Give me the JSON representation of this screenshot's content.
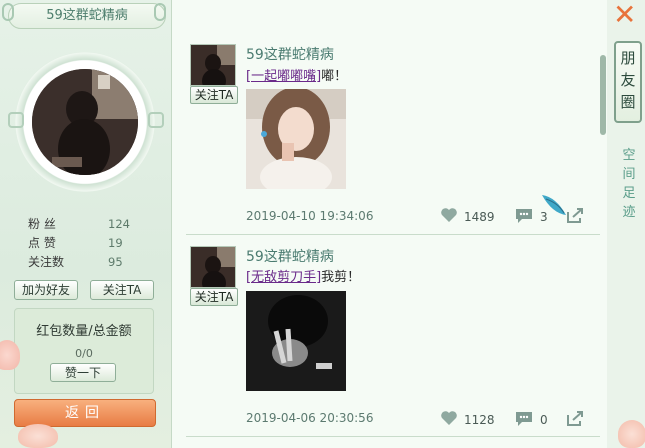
{
  "profile": {
    "name": "59这群蛇精病",
    "stats": [
      {
        "label": "粉 丝",
        "value": "124"
      },
      {
        "label": "点 赞",
        "value": "19"
      },
      {
        "label": "关注数",
        "value": "95"
      }
    ],
    "add_friend_label": "加为好友",
    "follow_label": "关注TA",
    "red_packet_title": "红包数量/总金额",
    "red_packet_count": "0/0",
    "like_button_label": "赞一下",
    "back_label": "返回"
  },
  "posts": [
    {
      "author": "59这群蛇精病",
      "follow_label": "关注TA",
      "tag": "[一起嘟嘟嘴]",
      "text": "嘟！",
      "date": "2019-04-10 19:34:06",
      "likes": "1489",
      "comments": "3"
    },
    {
      "author": "59这群蛇精病",
      "follow_label": "关注TA",
      "tag": "[无敌剪刀手]",
      "text": "我剪！",
      "date": "2019-04-06 20:30:56",
      "likes": "1128",
      "comments": "0"
    }
  ],
  "tabs": {
    "active": "朋友圈",
    "inactive": "空间足迹"
  },
  "close_label": "✕",
  "colors": {
    "accent_orange": "#e87c44",
    "name_green": "#4a7b70",
    "tag_purple": "#6a2a8a"
  }
}
